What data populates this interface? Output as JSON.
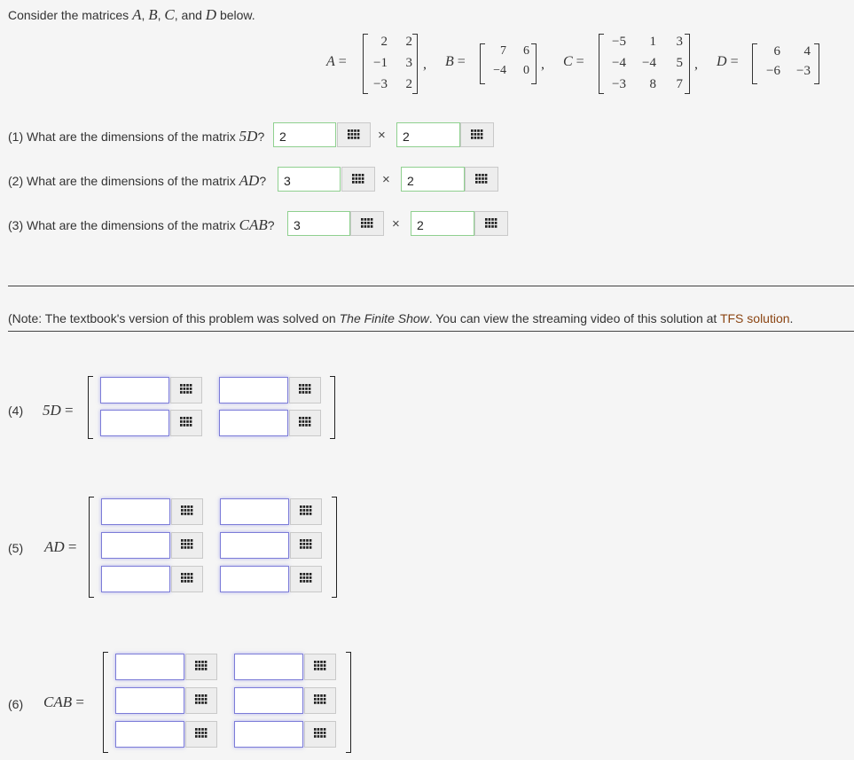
{
  "intro": {
    "prefix": "Consider the matrices ",
    "sep1": ", ",
    "sep2": ", ",
    "and": ", and ",
    "suffix": " below.",
    "names": [
      "A",
      "B",
      "C",
      "D"
    ]
  },
  "matrices": [
    {
      "name": "A",
      "rows": [
        [
          "2",
          "2"
        ],
        [
          "−1",
          "3"
        ],
        [
          "−3",
          "2"
        ]
      ]
    },
    {
      "name": "B",
      "rows": [
        [
          "7",
          "6"
        ],
        [
          "−4",
          "0"
        ]
      ]
    },
    {
      "name": "C",
      "rows": [
        [
          "−5",
          "1",
          "3"
        ],
        [
          "−4",
          "−4",
          "5"
        ],
        [
          "−3",
          "8",
          "7"
        ]
      ]
    },
    {
      "name": "D",
      "rows": [
        [
          "6",
          "4"
        ],
        [
          "−6",
          "−3"
        ]
      ]
    }
  ],
  "questions": [
    {
      "prefix": "(1) What are the dimensions of the matrix ",
      "expr": "5D",
      "suffix": "?",
      "rows_value": "2",
      "cols_value": "2"
    },
    {
      "prefix": "(2) What are the dimensions of the matrix ",
      "expr": "AD",
      "suffix": "?",
      "rows_value": "3",
      "cols_value": "2"
    },
    {
      "prefix": "(3) What are the dimensions of the matrix ",
      "expr": "CAB",
      "suffix": "?",
      "rows_value": "3",
      "cols_value": "2"
    }
  ],
  "times_symbol": "×",
  "note": {
    "prefix": "(Note: The textbook's version of this problem was solved on ",
    "show": "The Finite Show",
    "middle": ". You can view the streaming video of this solution at ",
    "link": "TFS solution",
    "suffix": "."
  },
  "answers": [
    {
      "number": "(4)",
      "expr": "5D",
      "equals": "="
    },
    {
      "number": "(5)",
      "expr": "AD",
      "equals": "="
    },
    {
      "number": "(6)",
      "expr": "CAB",
      "equals": "="
    }
  ],
  "icons": {
    "matrix_button": "grid-icon"
  },
  "colors": {
    "input_border": "#8fd08f",
    "answer_border": "#7c7cd8",
    "link": "#8b4513"
  }
}
